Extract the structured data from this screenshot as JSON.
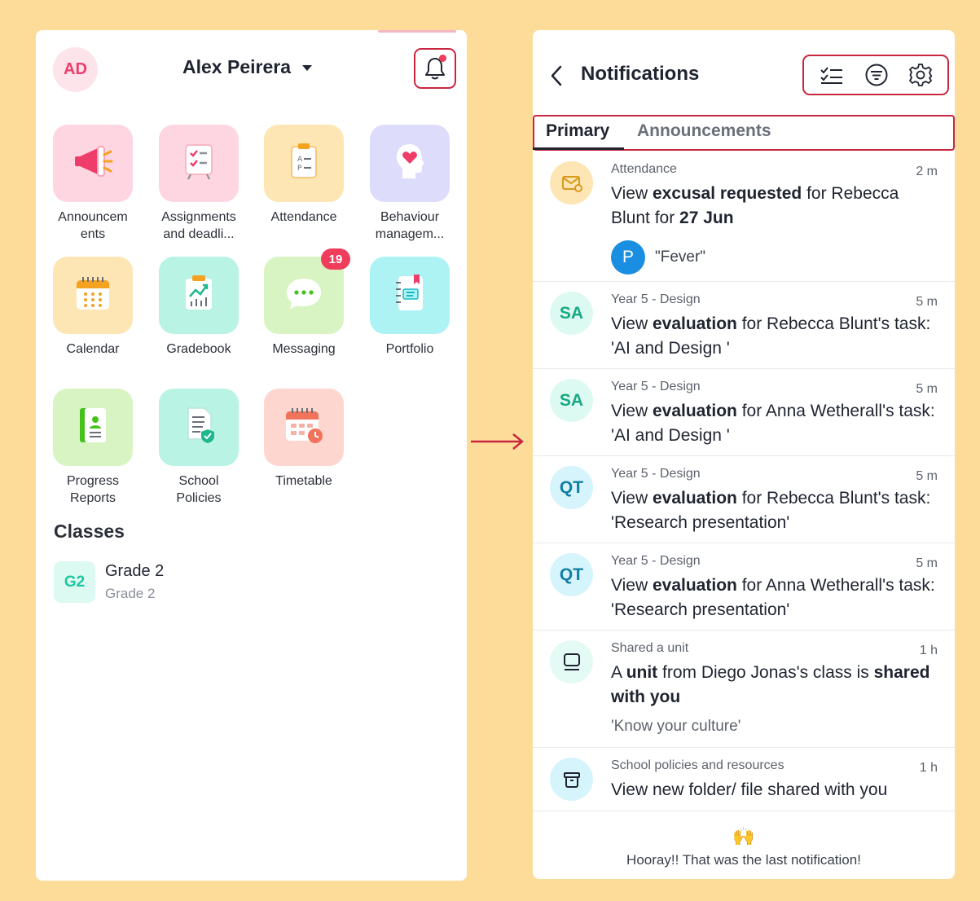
{
  "left": {
    "avatar_initials": "AD",
    "user_name": "Alex Peirera",
    "apps": [
      {
        "name": "announcements",
        "label": "Announcem\nents",
        "bg": "#fdd6e1"
      },
      {
        "name": "assignments",
        "label": "Assignments\nand deadli...",
        "bg": "#fdd6e1"
      },
      {
        "name": "attendance",
        "label": "Attendance",
        "bg": "#fde6b4"
      },
      {
        "name": "behaviour",
        "label": "Behaviour\nmanagem...",
        "bg": "#dedcfb"
      },
      {
        "name": "calendar",
        "label": "Calendar",
        "bg": "#fde6b4"
      },
      {
        "name": "gradebook",
        "label": "Gradebook",
        "bg": "#b9f3e4"
      },
      {
        "name": "messaging",
        "label": "Messaging",
        "bg": "#d8f4c3",
        "badge": "19"
      },
      {
        "name": "portfolio",
        "label": "Portfolio",
        "bg": "#aef3f4"
      },
      {
        "name": "progress-reports",
        "label": "Progress\nReports",
        "bg": "#d8f4c3"
      },
      {
        "name": "school-policies",
        "label": "School\nPolicies",
        "bg": "#b9f3e4"
      },
      {
        "name": "timetable",
        "label": "Timetable",
        "bg": "#fdd6d0"
      }
    ],
    "classes_heading": "Classes",
    "class": {
      "badge": "G2",
      "name": "Grade 2",
      "sub": "Grade 2"
    }
  },
  "right": {
    "title": "Notifications",
    "tabs": {
      "primary": "Primary",
      "announcements": "Announcements"
    },
    "notifications": [
      {
        "category": "Attendance",
        "time": "2 m",
        "initials": "",
        "icon": "envelope-icon",
        "circle_bg": "#fde6b4",
        "circle_fg": "#d99a1c",
        "pre": "View ",
        "b1": "excusal requested",
        "mid": " for Rebecca Blunt for ",
        "b2": "27 Jun",
        "post": "",
        "person_initial": "P",
        "person_quote": "\"Fever\""
      },
      {
        "category": "Year 5 - Design",
        "time": "5 m",
        "initials": "SA",
        "circle_bg": "#ddfaf2",
        "circle_fg": "#18a983",
        "pre": "View ",
        "b1": "evaluation",
        "mid": " for Rebecca Blunt's task: 'AI and Design '",
        "b2": "",
        "post": ""
      },
      {
        "category": "Year 5 - Design",
        "time": "5 m",
        "initials": "SA",
        "circle_bg": "#ddfaf2",
        "circle_fg": "#18a983",
        "pre": "View ",
        "b1": "evaluation",
        "mid": " for Anna Wetherall's task: 'AI and Design '",
        "b2": "",
        "post": ""
      },
      {
        "category": "Year 5 - Design",
        "time": "5 m",
        "initials": "QT",
        "circle_bg": "#d6f4fb",
        "circle_fg": "#137ea5",
        "pre": "View ",
        "b1": "evaluation",
        "mid": " for Rebecca Blunt's task: 'Research presentation'",
        "b2": "",
        "post": ""
      },
      {
        "category": "Year 5 - Design",
        "time": "5 m",
        "initials": "QT",
        "circle_bg": "#d6f4fb",
        "circle_fg": "#137ea5",
        "pre": "View ",
        "b1": "evaluation",
        "mid": " for Anna Wetherall's task: 'Research presentation'",
        "b2": "",
        "post": ""
      },
      {
        "category": "Shared a unit",
        "time": "1 h",
        "initials": "",
        "icon": "unit-icon",
        "circle_bg": "#e4faf4",
        "circle_fg": "#18a983",
        "pre": "A ",
        "b1": "unit",
        "mid": " from Diego Jonas's class is ",
        "b2": "shared with you",
        "post": "",
        "quote": "'Know your culture'"
      },
      {
        "category": "School policies and resources",
        "time": "1 h",
        "initials": "",
        "icon": "archive-icon",
        "circle_bg": "#d6f4fb",
        "circle_fg": "#137ea5",
        "pre": "View new folder/ file shared with you",
        "b1": "",
        "mid": "",
        "b2": "",
        "post": ""
      }
    ],
    "footer": {
      "emoji": "🙌",
      "text": "Hooray!! That was the last notification!"
    }
  },
  "colors": {
    "accent_red": "#c8263e",
    "page_bg": "#fddc9a"
  }
}
